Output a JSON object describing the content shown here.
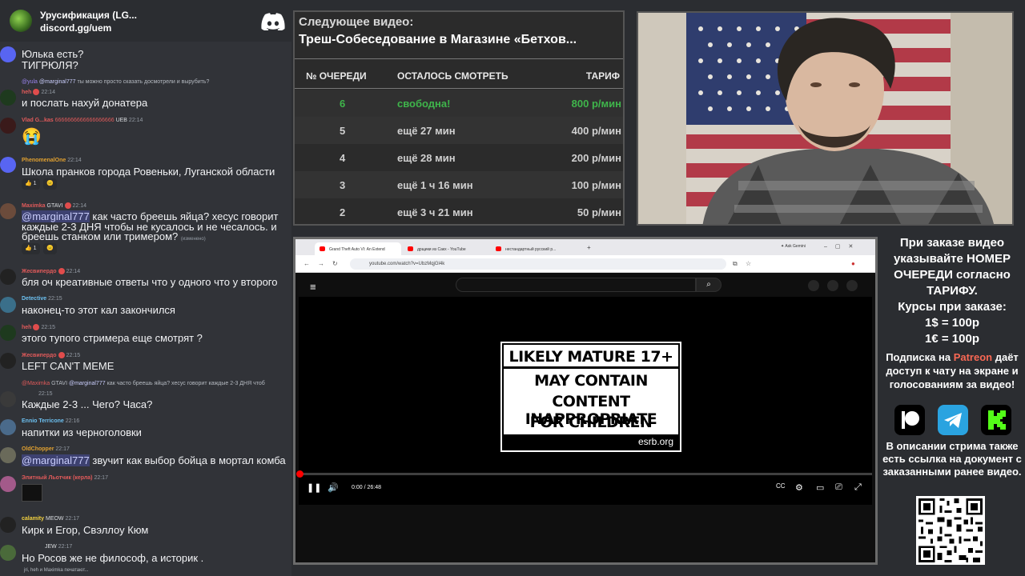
{
  "discord": {
    "server_name": "Урусификация (LG...",
    "server_invite": "discord.gg/uem",
    "messages": [
      {
        "author": "",
        "text": "Юлька есть?"
      },
      {
        "author": "",
        "text": "ТИГРЮЛЯ?"
      },
      {
        "reply_author": "@yula",
        "reply_mention": "@marginal777",
        "reply_text": "ты можно просто сказать досмотрели и вырубить?",
        "author": "heh",
        "time": "22:14",
        "text": "и послать нахуй донатера"
      },
      {
        "author": "Vlad G...kas",
        "meta_extra": "6666666666666666666",
        "tag": "UEB",
        "time": "22:14",
        "text": "😭"
      },
      {
        "author": "PhenomenalOne",
        "time": "22:14",
        "text": "Школа пранков города Ровеньки, Луганской области",
        "reactions": [
          "👍 1",
          "😐"
        ]
      },
      {
        "author": "Maximka",
        "tag": "GTAVI",
        "time": "22:14",
        "mention": "@marginal777",
        "text": "как часто бреешь яйца? хесус говорит",
        "text2": "каждые 2-3 ДНЯ чтобы не кусалось и не чесалось. и",
        "text3": "бреешь станком или тримером?",
        "edited": "(изменено)",
        "reactions": [
          "👍 1",
          "😐"
        ]
      },
      {
        "author": "Жесвипердо",
        "time": "22:14",
        "text": "бля оч креативные ответы что у одного что у второго"
      },
      {
        "author": "Detective",
        "time": "22:15",
        "text": "наконец-то этот кал закончился"
      },
      {
        "author": "heh",
        "time": "22:15",
        "text": "этого тупого стримера еще смотрят ?"
      },
      {
        "author": "Жесвипердо",
        "time": "22:15",
        "text": "LEFT CAN'T MEME"
      },
      {
        "reply_author": "@Maximka",
        "reply_tag": "GTAVI",
        "reply_mention": "@marginal777",
        "reply_text": "как часто бреешь яйца? хесус говорит каждые 2-3 ДНЯ чтоб",
        "author": "",
        "time": "22:15",
        "text": "Каждые 2-3 ... Чего? Часа?"
      },
      {
        "author": "Ennio Terricone",
        "time": "22:16",
        "text": "напитки из черноголовки"
      },
      {
        "author": "OldChopper",
        "time": "22:17",
        "mention": "@marginal777",
        "text": "звучит как выбор бойца в мортал комба"
      },
      {
        "author": "Элитный Льотчик (керла)",
        "time": "22:17",
        "text": ""
      },
      {
        "author": "calamity",
        "tag": "MEOW",
        "time": "22:17",
        "text": "Кирк и Егор, Свэллоу Кюм"
      },
      {
        "author": "",
        "tag": "JEW",
        "time": "22:17",
        "text": "Но Росов же не философ, а историк ."
      }
    ],
    "typing": "jri, heh и Maximka печатают..."
  },
  "queue": {
    "next_label": "Следующее видео:",
    "next_title": "Треш-Собеседование в Магазине «Бетхов...",
    "headers": {
      "num": "№ ОЧЕРЕДИ",
      "left": "ОСТАЛОСЬ СМОТРЕТЬ",
      "rate": "ТАРИФ"
    },
    "rows": [
      {
        "num": "6",
        "left": "свободна!",
        "rate": "800 р/мин"
      },
      {
        "num": "5",
        "left": "ещё 27 мин",
        "rate": "400 р/мин"
      },
      {
        "num": "4",
        "left": "ещё 28 мин",
        "rate": "200 р/мин"
      },
      {
        "num": "3",
        "left": "ещё 1 ч 16 мин",
        "rate": "100 р/мин"
      },
      {
        "num": "2",
        "left": "ещё 3 ч 21 мин",
        "rate": "50 р/мин"
      }
    ],
    "colors": {
      "free": "#3fb54b"
    }
  },
  "browser": {
    "tabs": [
      "Grand Theft Auto VI: An Extend",
      "дрщики из Сакх - YouTube",
      "нестандартный русский р..."
    ],
    "new_tab": "+",
    "ask_gemini": "Ask Gemini",
    "url": "youtube.com/watch?v=UbzMqjGl4k",
    "time": "0:00 / 26:48",
    "progress": 0.0
  },
  "esrb": {
    "top": "LIKELY MATURE 17+",
    "line1": "MAY CONTAIN",
    "line2": "CONTENT INAPPROPRIATE",
    "line3": "FOR CHILDREN",
    "site": "esrb.org"
  },
  "info": {
    "p1": "При заказе видео указывайте НОМЕР ОЧЕРЕДИ согласно ТАРИФУ.",
    "rates_title": "Курсы при заказе:",
    "rate_usd": "1$ = 100р",
    "rate_eur": "1€ = 100р",
    "sub_pre": "Подписка на ",
    "sub_brand": "Patreon",
    "sub_post": " даёт доступ к чату на экране и голосованиям за видео!",
    "desc": "В описании стрима также есть ссылка на документ с заказанными ранее видео.",
    "social_icons": [
      "patreon-icon",
      "telegram-icon",
      "kick-icon"
    ],
    "colors": {
      "patreon": "#f96854",
      "telegram": "#2aa3e0",
      "kick": "#53fc18"
    }
  }
}
